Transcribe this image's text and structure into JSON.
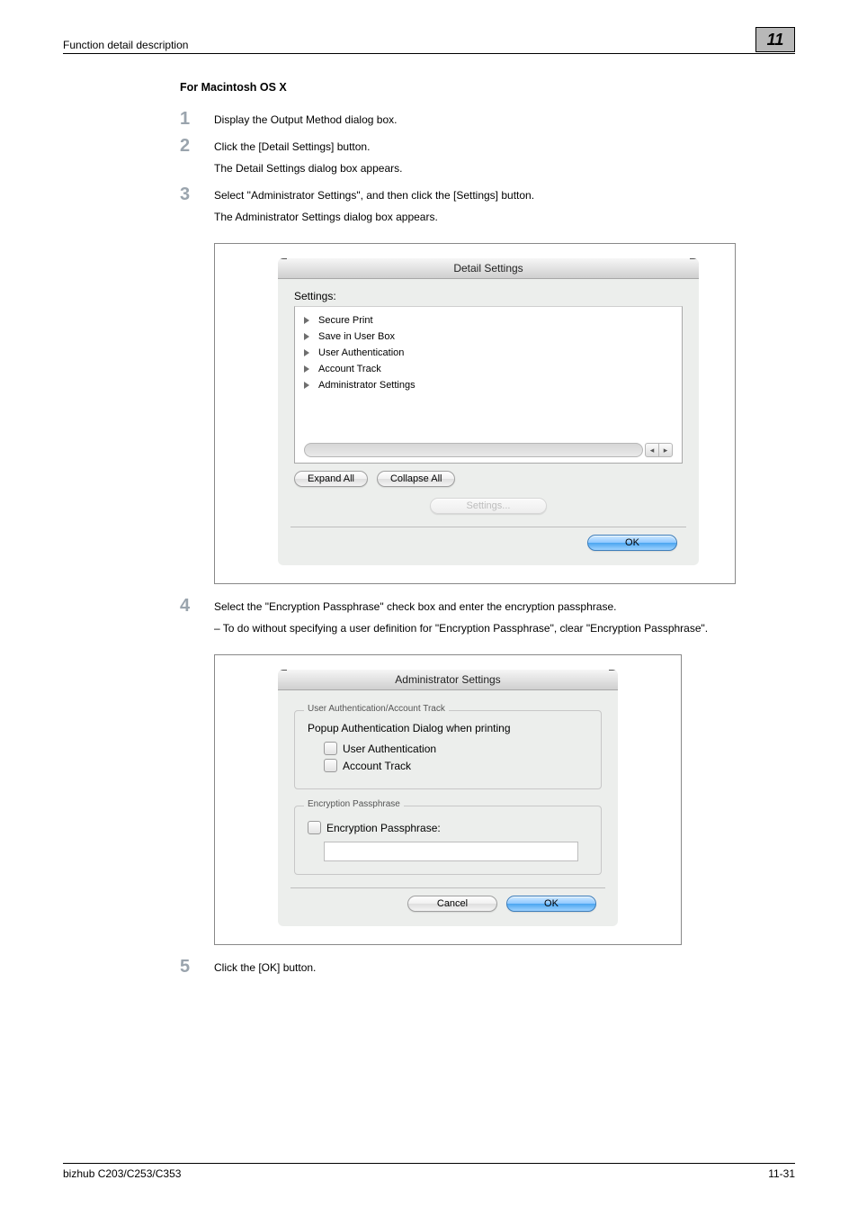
{
  "header": {
    "breadcrumb": "Function detail description",
    "chapter": "11"
  },
  "h1": "For Macintosh OS X",
  "steps": {
    "s1": {
      "num": "1",
      "body": "Display the Output Method dialog box."
    },
    "s2": {
      "num": "2",
      "body": "Click the [Detail Settings] button.",
      "extra": "The Detail Settings dialog box appears."
    },
    "s3": {
      "num": "3",
      "body": "Select \"Administrator Settings\", and then click the [Settings] button.",
      "extra": "The Administrator Settings dialog box appears."
    },
    "s4": {
      "num": "4",
      "body": "Select the \"Encryption Passphrase\" check box and enter the encryption passphrase.",
      "sub": "–   To do without specifying a user definition for \"Encryption Passphrase\", clear \"Encryption Passphrase\"."
    },
    "s5": {
      "num": "5",
      "body": "Click the [OK] button."
    }
  },
  "detail_settings": {
    "title": "Detail Settings",
    "settings_label": "Settings:",
    "items": {
      "i0": "Secure Print",
      "i1": "Save in User Box",
      "i2": "User Authentication",
      "i3": "Account Track",
      "i4": "Administrator Settings"
    },
    "expand": "Expand All",
    "collapse": "Collapse All",
    "settings_btn": "Settings...",
    "ok": "OK"
  },
  "admin_settings": {
    "title": "Administrator Settings",
    "group1_label": "User Authentication/Account Track",
    "group1_title": "Popup Authentication Dialog when printing",
    "check1": "User Authentication",
    "check2": "Account Track",
    "group2_label": "Encryption Passphrase",
    "check3": "Encryption Passphrase:",
    "cancel": "Cancel",
    "ok": "OK"
  },
  "footer": {
    "left": "bizhub C203/C253/C353",
    "right": "11-31"
  }
}
